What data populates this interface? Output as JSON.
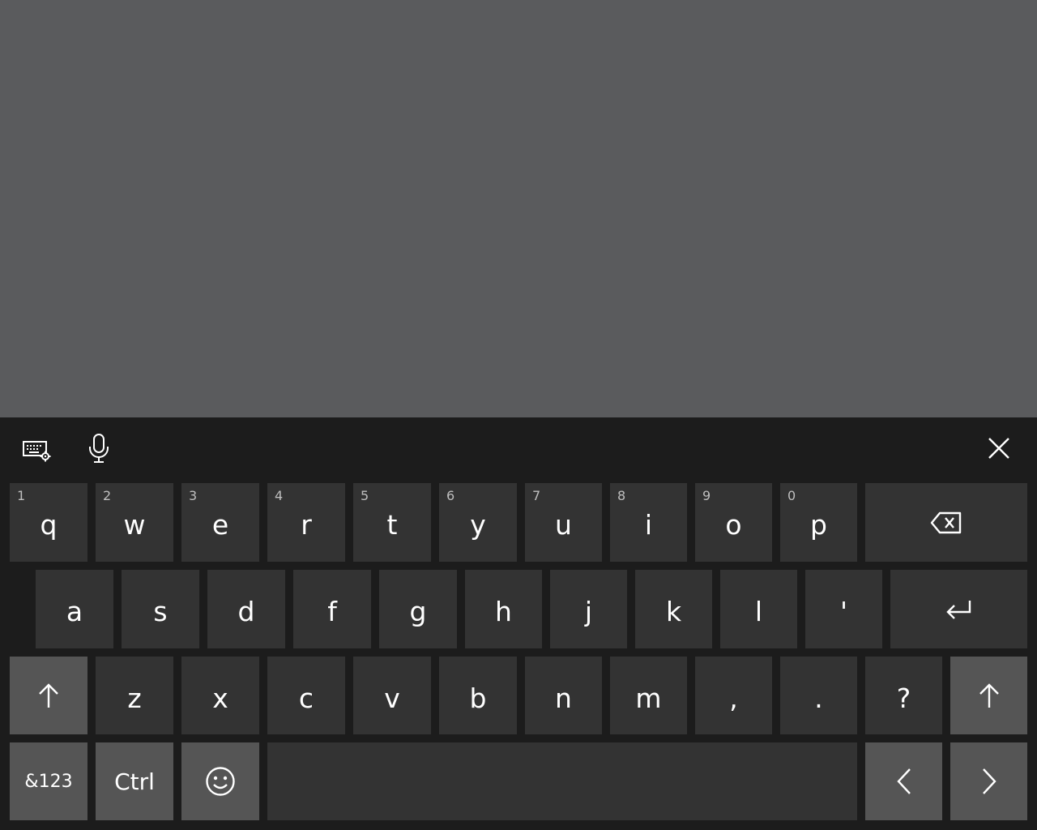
{
  "toolbar": {
    "keyboard_settings_icon": "keyboard-settings-icon",
    "microphone_icon": "microphone-icon",
    "close_icon": "close-icon"
  },
  "rows": {
    "row1": [
      {
        "key": "q",
        "sub": "1"
      },
      {
        "key": "w",
        "sub": "2"
      },
      {
        "key": "e",
        "sub": "3"
      },
      {
        "key": "r",
        "sub": "4"
      },
      {
        "key": "t",
        "sub": "5"
      },
      {
        "key": "y",
        "sub": "6"
      },
      {
        "key": "u",
        "sub": "7"
      },
      {
        "key": "i",
        "sub": "8"
      },
      {
        "key": "o",
        "sub": "9"
      },
      {
        "key": "p",
        "sub": "0"
      }
    ],
    "row2": [
      {
        "key": "a"
      },
      {
        "key": "s"
      },
      {
        "key": "d"
      },
      {
        "key": "f"
      },
      {
        "key": "g"
      },
      {
        "key": "h"
      },
      {
        "key": "j"
      },
      {
        "key": "k"
      },
      {
        "key": "l"
      },
      {
        "key": "'"
      }
    ],
    "row3": [
      {
        "key": "z"
      },
      {
        "key": "x"
      },
      {
        "key": "c"
      },
      {
        "key": "v"
      },
      {
        "key": "b"
      },
      {
        "key": "n"
      },
      {
        "key": "m"
      },
      {
        "key": ","
      },
      {
        "key": "."
      },
      {
        "key": "?"
      }
    ]
  },
  "bottom": {
    "symbols_label": "&123",
    "ctrl_label": "Ctrl"
  },
  "colors": {
    "backdrop": "#5a5b5d",
    "keyboard_bg": "#1c1c1c",
    "key_bg": "#333333",
    "key_light_bg": "#555555",
    "key_text": "#ffffff"
  }
}
